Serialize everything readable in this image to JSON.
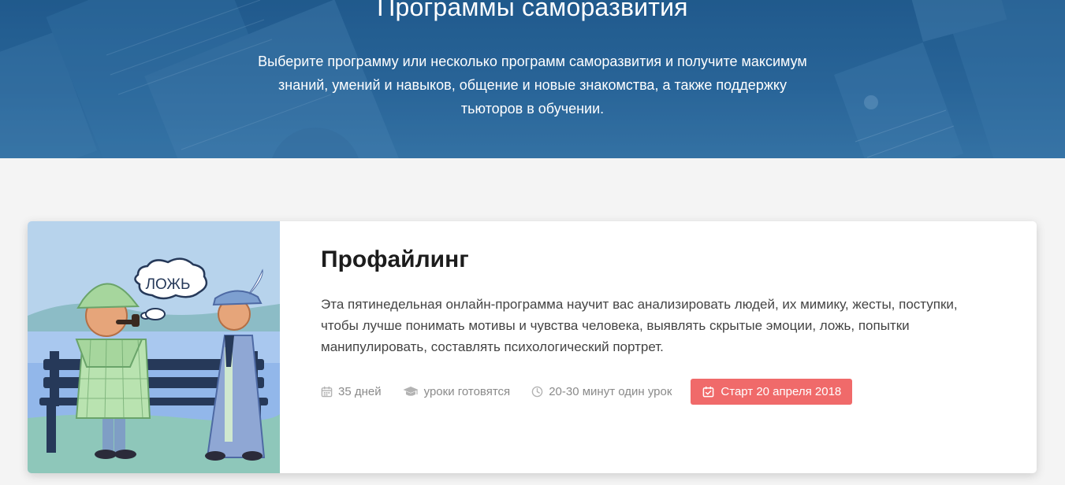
{
  "hero": {
    "title": "Программы саморазвития",
    "description_lines": [
      "Выберите программу или несколько программ саморазвития и получите максимум",
      "знаний, умений и навыков, общение и новые знакомства, а также поддержку",
      "тьюторов в обучении."
    ]
  },
  "program": {
    "title": "Профайлинг",
    "description_lines": [
      "Эта пятинедельная онлайн-программа научит вас анализировать людей, их мимику, жесты, поступки,",
      "чтобы лучше понимать мотивы и чувства человека, выявлять скрытые эмоции, ложь, попытки",
      "манипулировать, составлять психологический портрет."
    ],
    "illustration_bubble_text": "ЛОЖЬ",
    "meta": {
      "duration": "35 дней",
      "lessons": "уроки готовятся",
      "lesson_time": "20-30 минут один урок"
    },
    "start_badge": "Старт 20 апреля 2018"
  },
  "icons": {
    "duration": "calendar-icon",
    "lessons": "graduation-cap-icon",
    "lesson_time": "clock-icon",
    "start": "calendar-check-icon"
  },
  "colors": {
    "hero_background": "#2d6b9f",
    "accent_badge": "#f06a6a",
    "meta_text": "#8a8a8a",
    "title_text": "#1c1c1c",
    "page_background": "#f4f4f4"
  }
}
